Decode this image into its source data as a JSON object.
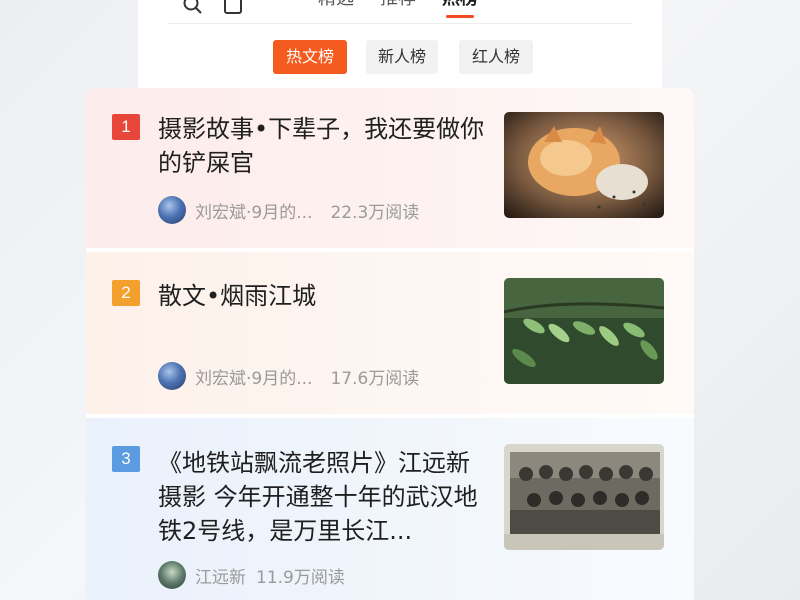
{
  "header": {
    "top_tabs": [
      {
        "label": "精选"
      },
      {
        "label": "推荐"
      },
      {
        "label": "热榜"
      }
    ],
    "rank_tabs": [
      {
        "label": "热文榜"
      },
      {
        "label": "新人榜"
      },
      {
        "label": "红人榜"
      }
    ]
  },
  "list": [
    {
      "rank": "1",
      "title": "摄影故事•下辈子，我还要做你的铲屎官",
      "author": "刘宏斌·9月的...",
      "views": "22.3万阅读",
      "thumb": "cat-photo",
      "badge_color": "#e8463b"
    },
    {
      "rank": "2",
      "title": "散文•烟雨江城",
      "author": "刘宏斌·9月的...",
      "views": "17.6万阅读",
      "thumb": "leaves-photo",
      "badge_color": "#f3a12c"
    },
    {
      "rank": "3",
      "title": "《地铁站飘流老照片》江远新摄影 今年开通整十年的武汉地铁2号线，是万里长江...",
      "author": "江远新",
      "views": "11.9万阅读",
      "thumb": "old-group-photo",
      "badge_color": "#5b9be0"
    }
  ],
  "colors": {
    "accent": "#f55b1f",
    "active_underline": "#f04b22"
  }
}
